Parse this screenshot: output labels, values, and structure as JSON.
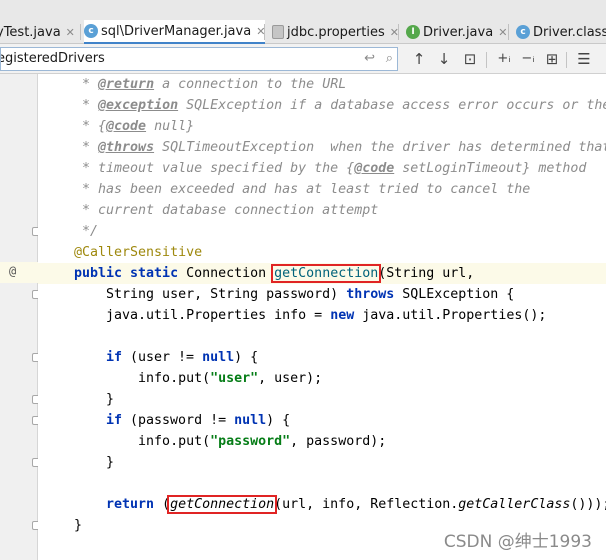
{
  "tabs": [
    {
      "label": "yTest.java",
      "icon": "class-icon",
      "active": false
    },
    {
      "label": "sql\\DriverManager.java",
      "icon": "class-icon",
      "active": true
    },
    {
      "label": "jdbc.properties",
      "icon": "properties-file-icon",
      "active": false
    },
    {
      "label": "Driver.java",
      "icon": "interface-icon",
      "active": false
    },
    {
      "label": "Driver.class",
      "icon": "class-icon",
      "active": false
    }
  ],
  "search": {
    "value": "egisteredDrivers",
    "enter_glyph": "↩",
    "search_glyph": "⌕"
  },
  "toolbar": {
    "up": "↑",
    "down": "↓",
    "prev_occurrence": "⊡",
    "add_selection": "+ᵢ",
    "remove_selection": "−ᵢ",
    "select_all": "⊞",
    "filter": "▽",
    "options": "☰"
  },
  "code": {
    "l1a": " * ",
    "l1tag": "@return",
    "l1b": " a connection to the URL",
    "l2a": " * ",
    "l2tag": "@exception",
    "l2ref": " SQLException",
    "l2b": " if a database access error occurs or the",
    "l3a": " * {",
    "l3tag": "@code",
    "l3b": " null}",
    "l4a": " * ",
    "l4tag": "@throws",
    "l4ref": " SQLTimeoutException",
    "l4b": "  when the driver has determined that",
    "l5a": " * timeout value specified by the {",
    "l5tag": "@code",
    "l5b": " setLoginTimeout} method",
    "l6": " * has been exceeded and has at least tried to cancel the",
    "l7": " * current database connection attempt",
    "l8": " */",
    "l9": "@CallerSensitive",
    "l10kw": "public static",
    "l10a": " Connection ",
    "l10m": "getConnection",
    "l10b": "(String url,",
    "l11a": "    String user, String password) ",
    "l11kw": "throws",
    "l11b": " SQLException {",
    "l12a": "    java.util.Properties info = ",
    "l12kw": "new",
    "l12b": " java.util.Properties();",
    "l14kw": "if",
    "l14a": " (user != ",
    "l14kw2": "null",
    "l14b": ") {",
    "l15a": "        info.put(",
    "l15s": "\"user\"",
    "l15b": ", user);",
    "l16": "    }",
    "l17kw": "if",
    "l17a": " (password != ",
    "l17kw2": "null",
    "l17b": ") {",
    "l18a": "        info.put(",
    "l18s": "\"password\"",
    "l18b": ", password);",
    "l19": "    }",
    "l21kw": "return",
    "l21a": " (",
    "l21m": "getConnection",
    "l21b": "(url, info, Reflection.",
    "l21c": "getCallerClass",
    "l21d": "()));",
    "l22": "}"
  },
  "gutter_marker": "@",
  "watermark": "CSDN @绅士1993",
  "colors": {
    "highlight_box": "#e02424",
    "keyword": "#0033b3",
    "annotation": "#9e880d",
    "string": "#067d17",
    "doc_comment": "#8c8c8c",
    "current_line": "#fcfae8"
  }
}
